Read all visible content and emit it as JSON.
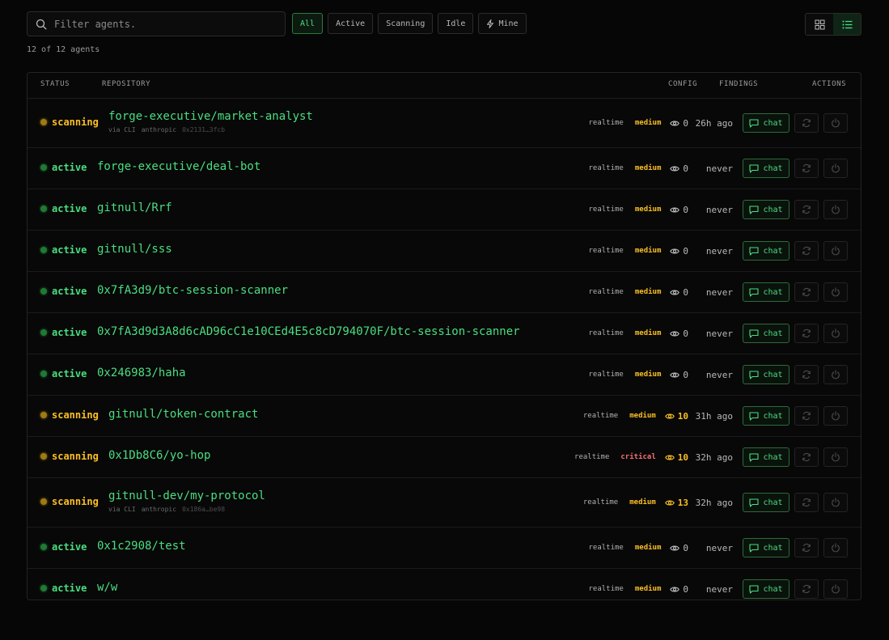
{
  "search": {
    "placeholder": "Filter agents.",
    "value": ""
  },
  "filters": [
    {
      "label": "All",
      "active": true
    },
    {
      "label": "Active",
      "active": false
    },
    {
      "label": "Scanning",
      "active": false
    },
    {
      "label": "Idle",
      "active": false
    },
    {
      "label": "Mine",
      "active": false,
      "icon": "lightning-icon"
    }
  ],
  "view": {
    "grid_icon": "grid-icon",
    "list_icon": "list-icon",
    "selected": "list"
  },
  "count_text": "12 of 12 agents",
  "table": {
    "headers": {
      "status": "STATUS",
      "repository": "REPOSITORY",
      "config": "CONFIG",
      "findings": "FINDINGS",
      "actions": "ACTIONS"
    },
    "rows": [
      {
        "status": "scanning",
        "repo": "forge-executive/market-analyst",
        "sub": [
          "via CLI",
          "anthropic",
          "0x2131…3fcb"
        ],
        "config": "realtime",
        "severity": "medium",
        "findings": "0",
        "last": "26h ago"
      },
      {
        "status": "active",
        "repo": "forge-executive/deal-bot",
        "config": "realtime",
        "severity": "medium",
        "findings": "0",
        "last": "never"
      },
      {
        "status": "active",
        "repo": "gitnull/Rrf",
        "config": "realtime",
        "severity": "medium",
        "findings": "0",
        "last": "never"
      },
      {
        "status": "active",
        "repo": "gitnull/sss",
        "config": "realtime",
        "severity": "medium",
        "findings": "0",
        "last": "never"
      },
      {
        "status": "active",
        "repo": "0x7fA3d9/btc-session-scanner",
        "config": "realtime",
        "severity": "medium",
        "findings": "0",
        "last": "never"
      },
      {
        "status": "active",
        "repo": "0x7fA3d9d3A8d6cAD96cC1e10CEd4E5c8cD794070F/btc-session-scanner",
        "config": "realtime",
        "severity": "medium",
        "findings": "0",
        "last": "never"
      },
      {
        "status": "active",
        "repo": "0x246983/haha",
        "config": "realtime",
        "severity": "medium",
        "findings": "0",
        "last": "never"
      },
      {
        "status": "scanning",
        "repo": "gitnull/token-contract",
        "config": "realtime",
        "severity": "medium",
        "findings": "10",
        "last": "31h ago"
      },
      {
        "status": "scanning",
        "repo": "0x1Db8C6/yo-hop",
        "config": "realtime",
        "severity": "critical",
        "findings": "10",
        "last": "32h ago"
      },
      {
        "status": "scanning",
        "repo": "gitnull-dev/my-protocol",
        "sub": [
          "via CLI",
          "anthropic",
          "0x186a…be98"
        ],
        "config": "realtime",
        "severity": "medium",
        "findings": "13",
        "last": "32h ago"
      },
      {
        "status": "active",
        "repo": "0x1c2908/test",
        "config": "realtime",
        "severity": "medium",
        "findings": "0",
        "last": "never"
      },
      {
        "status": "active",
        "repo": "w/w",
        "config": "realtime",
        "severity": "medium",
        "findings": "0",
        "last": "never"
      }
    ],
    "chat_label": "chat"
  },
  "colors": {
    "accent": "#4ade80",
    "scanning": "#fbbf24",
    "critical": "#f87171",
    "background": "#060606"
  }
}
